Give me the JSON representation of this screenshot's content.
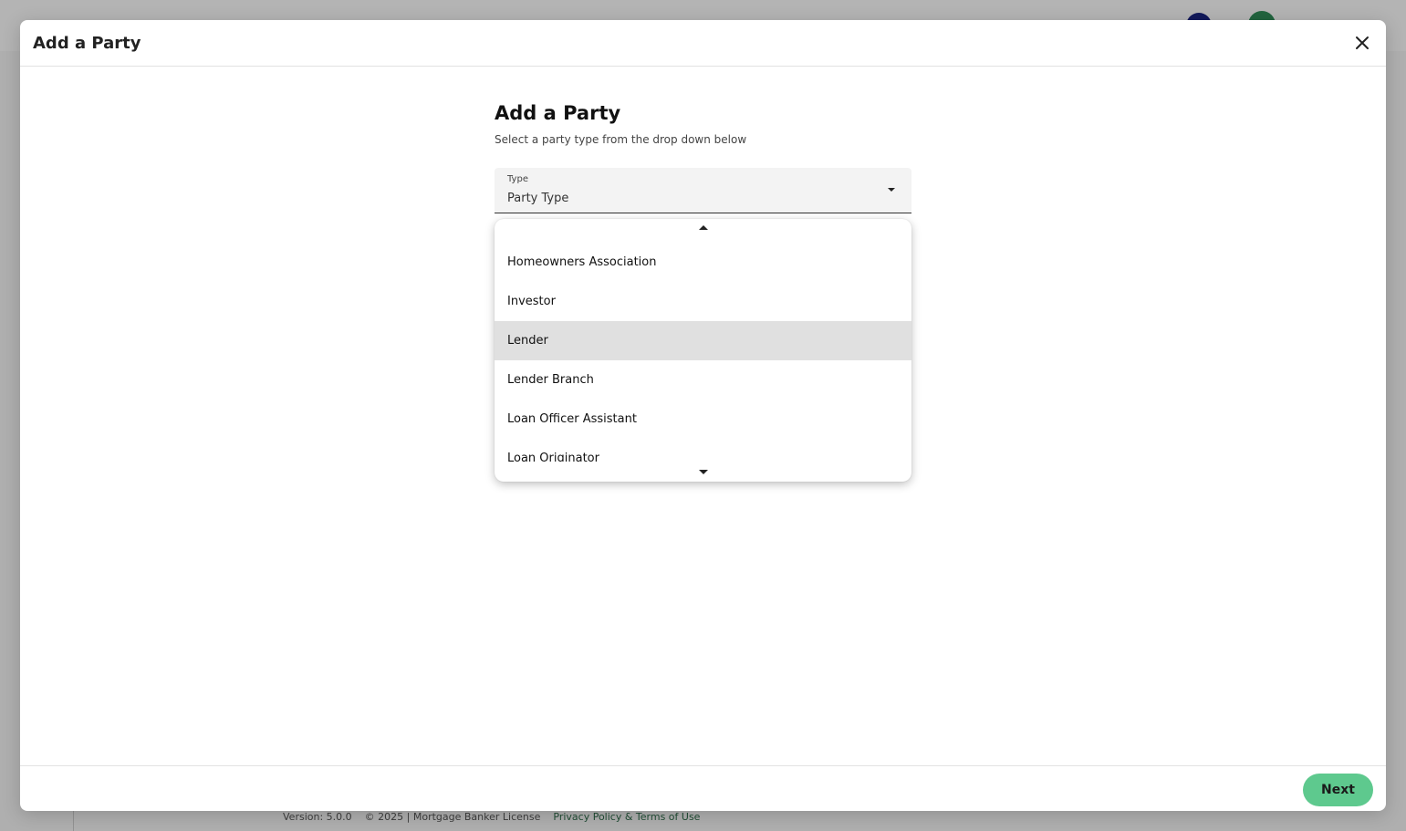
{
  "modal": {
    "title": "Add a Party",
    "heading": "Add a Party",
    "subtitle": "Select a party type from the drop down below",
    "next_label": "Next"
  },
  "select": {
    "label": "Type",
    "value": "Party Type"
  },
  "dropdown": {
    "options": [
      {
        "label": "Homeowners Association"
      },
      {
        "label": "Investor"
      },
      {
        "label": "Lender",
        "highlighted": true
      },
      {
        "label": "Lender Branch"
      },
      {
        "label": "Loan Officer Assistant"
      },
      {
        "label": "Loan Originator"
      }
    ]
  },
  "background": {
    "footer_version": "Version: 5.0.0",
    "footer_license": "© 2025 | Mortgage Banker License",
    "footer_link": "Privacy Policy & Terms of Use"
  },
  "colors": {
    "accent": "#5ec98e",
    "highlight": "#e0e0e0"
  },
  "icons": {
    "close": "close-icon",
    "caret": "caret-down-icon"
  }
}
